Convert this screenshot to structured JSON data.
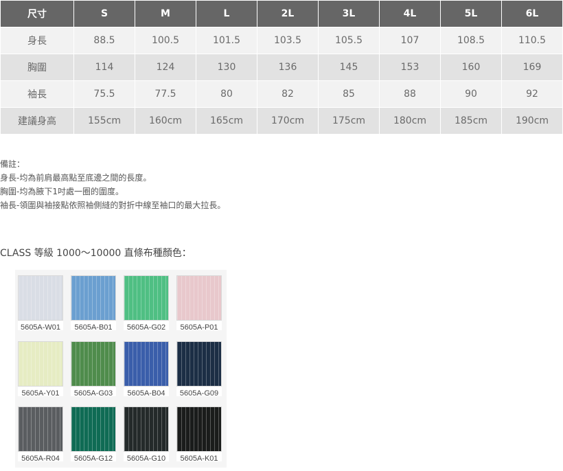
{
  "size_table": {
    "headers": [
      "尺寸",
      "S",
      "M",
      "L",
      "2L",
      "3L",
      "4L",
      "5L",
      "6L"
    ],
    "rows": [
      {
        "label": "身長",
        "values": [
          "88.5",
          "100.5",
          "101.5",
          "103.5",
          "105.5",
          "107",
          "108.5",
          "110.5"
        ]
      },
      {
        "label": "胸圍",
        "values": [
          "114",
          "124",
          "130",
          "136",
          "145",
          "153",
          "160",
          "169"
        ]
      },
      {
        "label": "袖長",
        "values": [
          "75.5",
          "77.5",
          "80",
          "82",
          "85",
          "88",
          "90",
          "92"
        ]
      },
      {
        "label": "建議身高",
        "values": [
          "155cm",
          "160cm",
          "165cm",
          "170cm",
          "175cm",
          "180cm",
          "185cm",
          "190cm"
        ]
      }
    ]
  },
  "notes": {
    "title": "備註：",
    "lines": [
      "身長-均為前肩最高點至底邊之間的長度。",
      "胸圍-均為腋下1吋處一圈的圍度。",
      "袖長-領圍與袖接點依照袖側縫的對折中線至袖口的最大拉長。"
    ]
  },
  "colors_section": {
    "title": "CLASS 等級 1000～10000 直條布種顏色：",
    "swatches": [
      {
        "code": "5605A-W01",
        "color": "#d9dde5"
      },
      {
        "code": "5605A-B01",
        "color": "#6b9fd0"
      },
      {
        "code": "5605A-G02",
        "color": "#4fbf83"
      },
      {
        "code": "5605A-P01",
        "color": "#e8c8cc"
      },
      {
        "code": "5605A-Y01",
        "color": "#e6ecc3"
      },
      {
        "code": "5605A-G03",
        "color": "#4f8c4c"
      },
      {
        "code": "5605A-B04",
        "color": "#3a5eaa"
      },
      {
        "code": "5605A-G09",
        "color": "#1c2e45"
      },
      {
        "code": "5605A-R04",
        "color": "#5a5d60"
      },
      {
        "code": "5605A-G12",
        "color": "#0f6b54"
      },
      {
        "code": "5605A-G10",
        "color": "#242a2a"
      },
      {
        "code": "5605A-K01",
        "color": "#1a1c1b"
      }
    ]
  }
}
